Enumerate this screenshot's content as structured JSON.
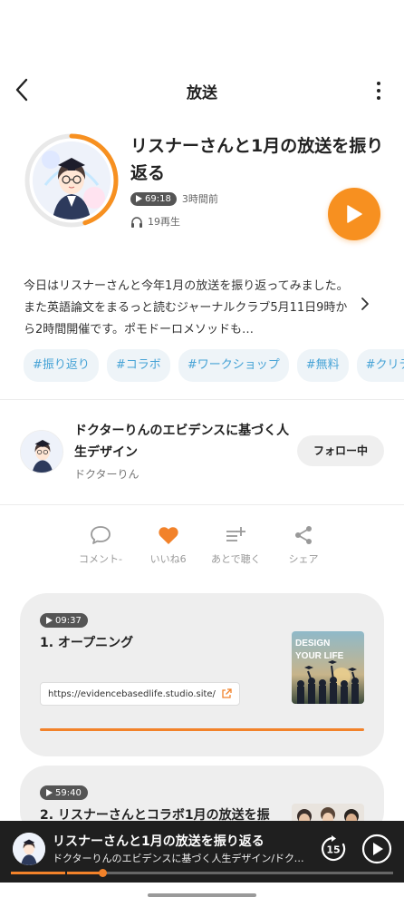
{
  "header": {
    "title": "放送"
  },
  "episode": {
    "title": "リスナーさんと1月の放送を振り返る",
    "duration": "69:18",
    "posted": "3時間前",
    "plays": "19再生",
    "progress_fraction": 0.45,
    "description": "今日はリスナーさんと今年1月の放送を振り返ってみました。また英語論文をまるっと読むジャーナルクラブ5月11日9時から2時間開催です。ポモドーロメソッドも…"
  },
  "tags": [
    "#振り返り",
    "#コラボ",
    "#ワークショップ",
    "#無料",
    "#クリティ"
  ],
  "channel": {
    "name": "ドクターりんのエビデンスに基づく人生デザイン",
    "host": "ドクターりん",
    "follow_label": "フォロー中"
  },
  "actions": {
    "comment": "コメント-",
    "like": "いいね6",
    "later": "あとで聴く",
    "share": "シェア"
  },
  "chapters": [
    {
      "time": "09:37",
      "title": "1. オープニング",
      "link": "https://evidencebasedlife.studio.site/",
      "thumb_text_1": "DESIGN",
      "thumb_text_2": "YOUR LIFE"
    },
    {
      "time": "59:40",
      "title": "2. リスナーさんとコラボ1月の放送を振"
    }
  ],
  "mini_player": {
    "title": "リスナーさんと1月の放送を振り返る",
    "subtitle": "ドクターりんのエビデンスに基づく人生デザイン/ドクターりん",
    "skip_label": "15",
    "progress_fraction": 0.24
  },
  "colors": {
    "accent": "#f79020",
    "tag_text": "#47a3d6",
    "tag_bg": "#eef4f8",
    "like": "#f2822a"
  }
}
